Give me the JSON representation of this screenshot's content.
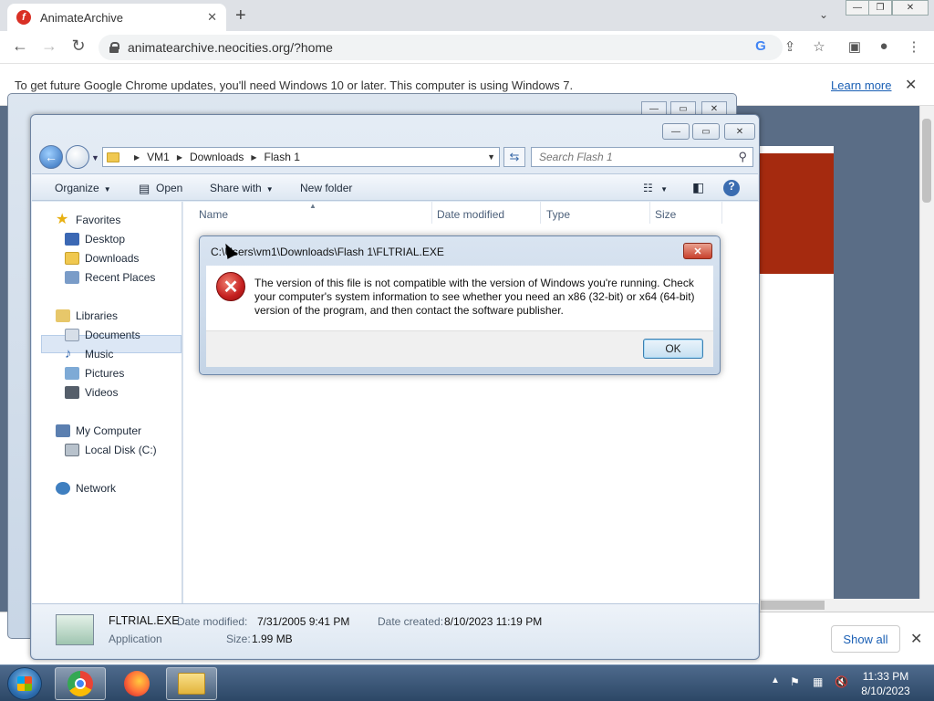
{
  "browser": {
    "tab_title": "AnimateArchive",
    "tab_favicon": "flash-icon",
    "url": "animatearchive.neocities.org/?home",
    "update_bar": {
      "message": "To get future Google Chrome updates, you'll need Windows 10 or later. This computer is using Windows 7.",
      "learn_more": "Learn more"
    },
    "download_bar": {
      "show_all": "Show all"
    }
  },
  "explorer": {
    "breadcrumb": [
      "VM1",
      "Downloads",
      "Flash 1"
    ],
    "search_placeholder": "Search Flash 1",
    "toolbar": {
      "organize": "Organize",
      "open": "Open",
      "share_with": "Share with",
      "new_folder": "New folder"
    },
    "nav": {
      "favorites": "Favorites",
      "desktop": "Desktop",
      "downloads": "Downloads",
      "recent_places": "Recent Places",
      "libraries": "Libraries",
      "documents": "Documents",
      "music": "Music",
      "pictures": "Pictures",
      "videos": "Videos",
      "my_computer": "My Computer",
      "local_disk": "Local Disk (C:)",
      "network": "Network"
    },
    "selected_nav": "Downloads",
    "columns": [
      "Name",
      "Date modified",
      "Type",
      "Size"
    ],
    "details": {
      "filename": "FLTRIAL.EXE",
      "date_modified_label": "Date modified:",
      "date_modified": "7/31/2005 9:41 PM",
      "date_created_label": "Date created:",
      "date_created": "8/10/2023 11:19 PM",
      "type": "Application",
      "size_label": "Size:",
      "size": "1.99 MB"
    }
  },
  "dialog": {
    "title": "C:\\Users\\vm1\\Downloads\\Flash 1\\FLTRIAL.EXE",
    "message": "The version of this file is not compatible with the version of Windows you're running. Check your computer's system information to see whether you need an x86 (32-bit) or x64 (64-bit) version of the program, and then contact the software publisher.",
    "ok": "OK"
  },
  "taskbar": {
    "time": "11:33 PM",
    "date": "8/10/2023"
  }
}
